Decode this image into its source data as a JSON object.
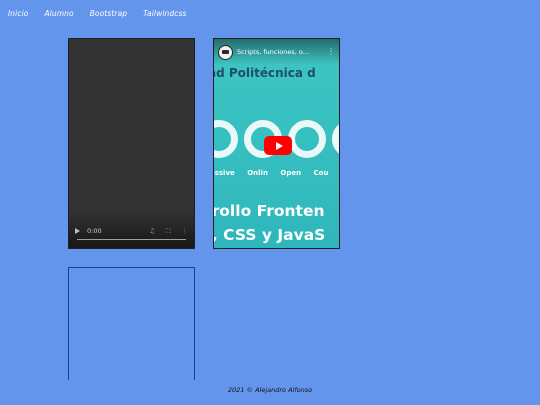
{
  "nav": {
    "items": [
      "Inicio",
      "Alumno",
      "Bootstrap",
      "Tailwindcss"
    ]
  },
  "video": {
    "time": "0:00",
    "icons": [
      "play-icon",
      "volume-icon",
      "fullscreen-icon",
      "more-icon"
    ]
  },
  "youtube": {
    "title": "Scripts, funciones, o...",
    "banner_line1": "ad Politécnica d",
    "banner_tags": [
      "assive",
      "Onlin",
      "Open",
      "Cou"
    ],
    "banner_line2": "rrollo Fronten",
    "banner_line3": "., CSS y JavaS",
    "accent": "#ff0000"
  },
  "footer": {
    "text": "2021 © Alejandro Alfonso"
  }
}
